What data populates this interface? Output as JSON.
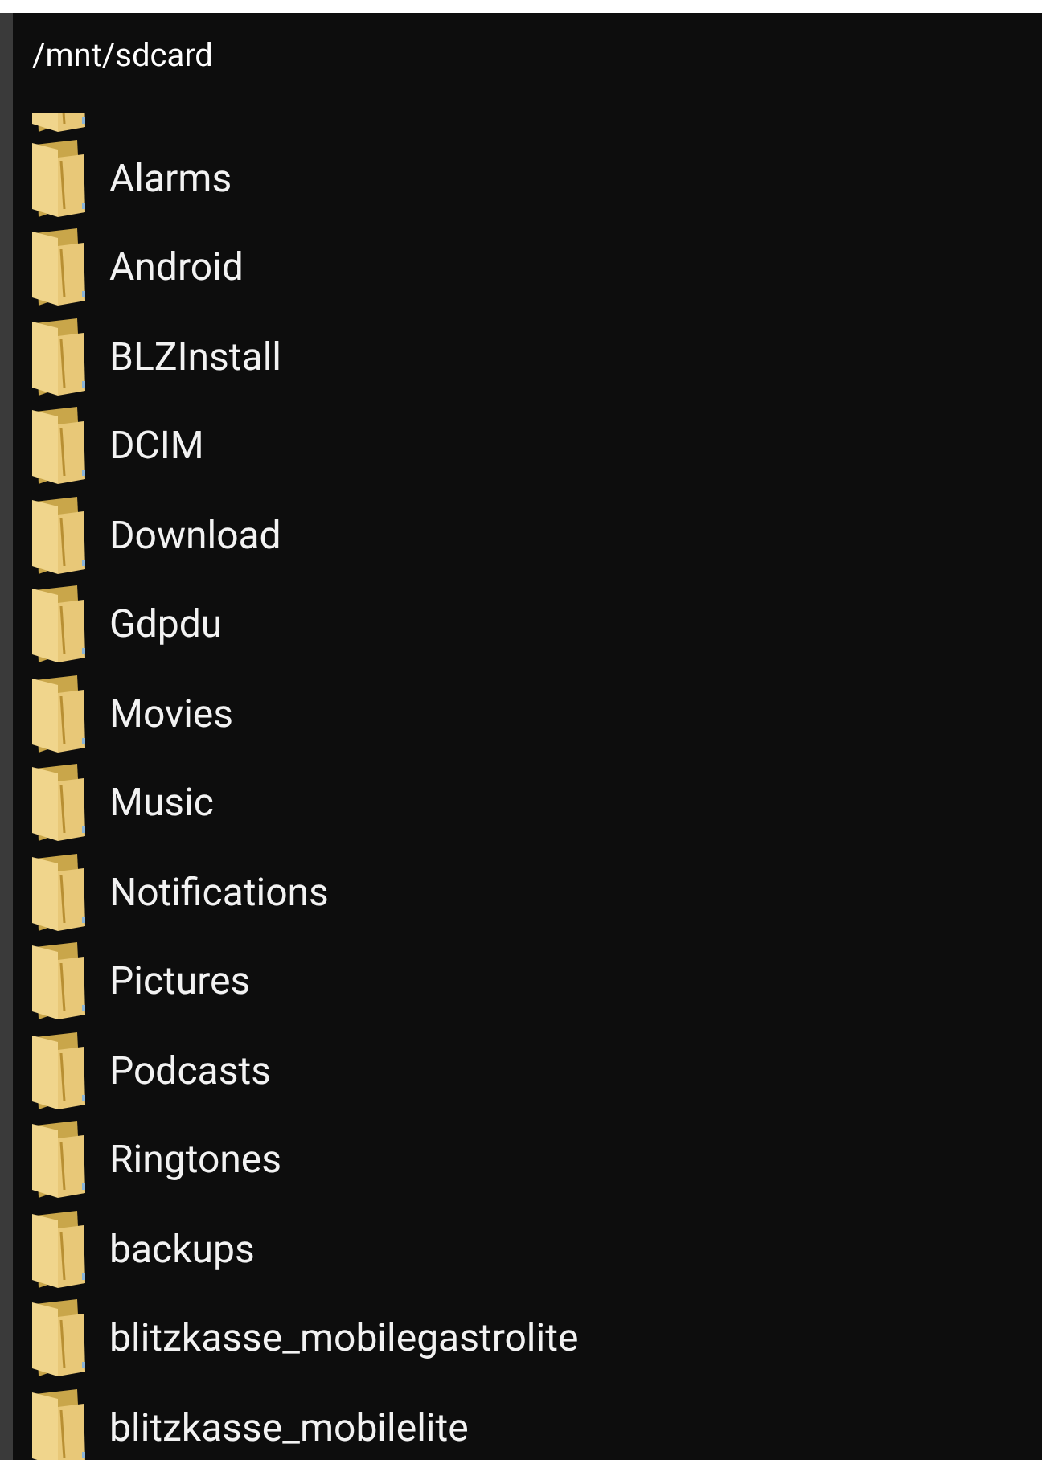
{
  "dialog": {
    "path": "/mnt/sdcard",
    "folders": [
      "Alarms",
      "Android",
      "BLZInstall",
      "DCIM",
      "Download",
      "Gdpdu",
      "Movies",
      "Music",
      "Notifications",
      "Pictures",
      "Podcasts",
      "Ringtones",
      "backups",
      "blitzkasse_mobilegastrolite",
      "blitzkasse_mobilelite"
    ]
  }
}
